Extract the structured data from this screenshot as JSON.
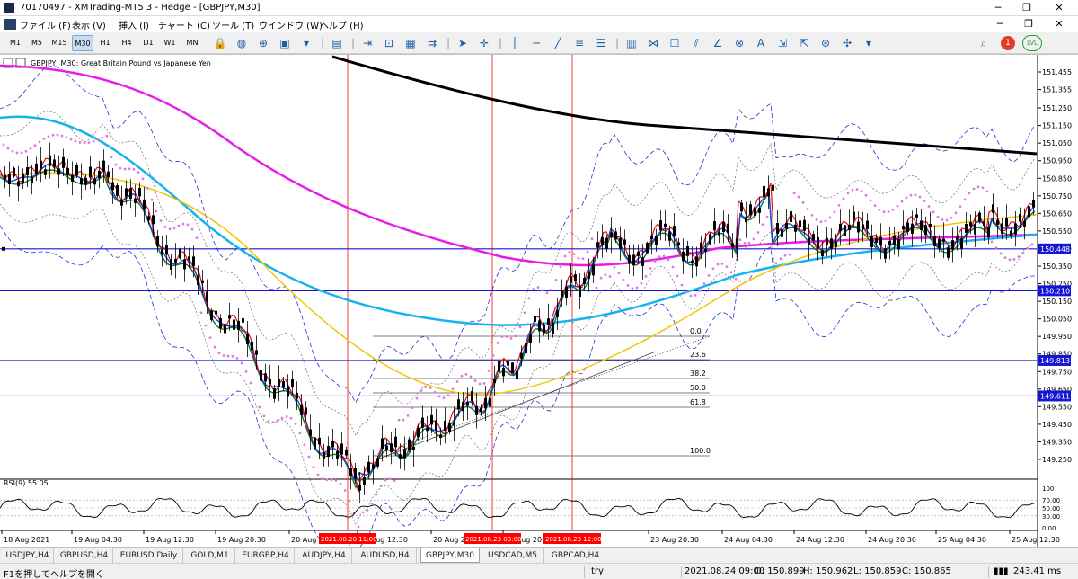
{
  "window": {
    "title": "70170497 - XMTrading-MT5 3 - Hedge - [GBPJPY,M30]",
    "minimize": "─",
    "restore": "❐",
    "close": "✕"
  },
  "menu": {
    "items": [
      "ファイル (F)",
      "表示 (V)",
      "挿入 (I)",
      "チャート (C)",
      "ツール (T)",
      "ウインドウ (W)",
      "ヘルプ (H)"
    ],
    "minimize": "─",
    "restore": "❐",
    "close": "✕"
  },
  "toolbar": {
    "timeframes": [
      "M1",
      "M5",
      "M15",
      "M30",
      "H1",
      "H4",
      "D1",
      "W1",
      "MN"
    ],
    "active_timeframe": "M30",
    "tools": [
      {
        "name": "lock-icon",
        "glyph": "🔒"
      },
      {
        "name": "stack-icon",
        "glyph": "◍"
      },
      {
        "name": "indicator-icon",
        "glyph": "⊕"
      },
      {
        "name": "template-icon",
        "glyph": "▣"
      },
      {
        "name": "dropdown-arrow-icon",
        "glyph": "▾"
      },
      {
        "name": "separator-icon",
        "glyph": "|"
      },
      {
        "name": "profile-icon",
        "glyph": "▤"
      },
      {
        "name": "separator-icon",
        "glyph": "|"
      },
      {
        "name": "autoscroll-icon",
        "glyph": "⇥"
      },
      {
        "name": "chart-shift-icon",
        "glyph": "⊡"
      },
      {
        "name": "trade-panel-icon",
        "glyph": "▦"
      },
      {
        "name": "depth-icon",
        "glyph": "⇉"
      },
      {
        "name": "separator-icon",
        "glyph": "|"
      },
      {
        "name": "cursor-icon",
        "glyph": "➤"
      },
      {
        "name": "crosshair-icon",
        "glyph": "✛"
      },
      {
        "name": "separator-icon",
        "glyph": "|"
      },
      {
        "name": "vertical-line-icon",
        "glyph": "│"
      },
      {
        "name": "horizontal-line-icon",
        "glyph": "─"
      },
      {
        "name": "trendline-icon",
        "glyph": "╱"
      },
      {
        "name": "equidistant-channel-icon",
        "glyph": "≡"
      },
      {
        "name": "fibonacci-icon",
        "glyph": "☰"
      },
      {
        "name": "separator-icon",
        "glyph": "|"
      },
      {
        "name": "gann-icon",
        "glyph": "▥"
      },
      {
        "name": "andrews-pitchfork-icon",
        "glyph": "⋈"
      },
      {
        "name": "rectangle-icon",
        "glyph": "☐"
      },
      {
        "name": "lines-icon",
        "glyph": "⫽"
      },
      {
        "name": "angle-icon",
        "glyph": "∠"
      },
      {
        "name": "shapes-icon",
        "glyph": "⊗"
      },
      {
        "name": "text-icon",
        "glyph": "A"
      },
      {
        "name": "fibo-fan-icon",
        "glyph": "⇲"
      },
      {
        "name": "fibo-arcs-icon",
        "glyph": "⇱"
      },
      {
        "name": "elliott-icon",
        "glyph": "⊛"
      },
      {
        "name": "arrows-icon",
        "glyph": "✣"
      },
      {
        "name": "dropdown-arrow-icon",
        "glyph": "▾"
      }
    ],
    "search_icon": "⌕",
    "notification_count": "1",
    "level_badge": "LVL"
  },
  "chart": {
    "header": "GBPJPY, M30:  Great Britain Pound vs Japanese Yen",
    "price_axis": [
      "151.455",
      "151.355",
      "151.250",
      "151.150",
      "151.050",
      "150.950",
      "150.850",
      "150.750",
      "150.650",
      "150.550",
      "150.455",
      "150.350",
      "150.250",
      "150.150",
      "150.050",
      "149.950",
      "149.850",
      "149.750",
      "149.650",
      "149.550",
      "149.450",
      "149.350",
      "149.250"
    ],
    "hlines": [
      {
        "label": "150.448",
        "value": 150.448
      },
      {
        "label": "150.210",
        "value": 150.21
      },
      {
        "label": "149.813",
        "value": 149.813
      },
      {
        "label": "149.611",
        "value": 149.611
      }
    ],
    "fib_levels": [
      "0.0",
      "23.6",
      "38.2",
      "50.0",
      "61.8",
      "100.0"
    ],
    "rsi_label": "RSI(9) 55.05",
    "rsi_axis": [
      "100",
      "70.00",
      "50.00",
      "30.00",
      "0.00"
    ],
    "time_axis": [
      "18 Aug 2021",
      "19 Aug 04:30",
      "19 Aug 12:30",
      "19 Aug 20:30",
      "20 Aug 0",
      "20 Aug 12:30",
      "20 Aug 2",
      "20 Aug 20:30",
      "23 Aug 20:30",
      "24 Aug 04:30",
      "24 Aug 12:30",
      "24 Aug 20:30",
      "25 Aug 04:30",
      "25 Aug 12:30"
    ],
    "time_markers": [
      "2021.08.20 11:00",
      "2021.08.23 03:00",
      "2021.08.23 12:00"
    ]
  },
  "colors": {
    "price_bar": "#000000",
    "hline": "#1515d6",
    "vline": "#ff0000",
    "ma_black": "#000000",
    "ma_magenta": "#e81ce8",
    "ma_cyan": "#16b4ee",
    "ma_yellow": "#f2c500",
    "ma_green": "#0a7a2a",
    "ma_blue": "#1f3fd8",
    "ma_red": "#e01010",
    "bollinger": "#2a2ad6",
    "psar": "#e07ae0"
  },
  "tabs": [
    "USDJPY,H4",
    "GBPUSD,H4",
    "EURUSD,Daily",
    "GOLD,M1",
    "EURGBP,H4",
    "AUDJPY,H4",
    "AUDUSD,H4",
    "GBPJPY,M30",
    "USDCAD,M5",
    "GBPCAD,H4"
  ],
  "active_tab": "GBPJPY,M30",
  "status": {
    "help": "F1を押してヘルプを開く",
    "profile": "try",
    "time": "2021.08.24 09:00",
    "open": "O: 150.899",
    "high": "H: 150.962",
    "low": "L: 150.859",
    "close": "C: 150.865",
    "traffic": "243.41 ms"
  }
}
